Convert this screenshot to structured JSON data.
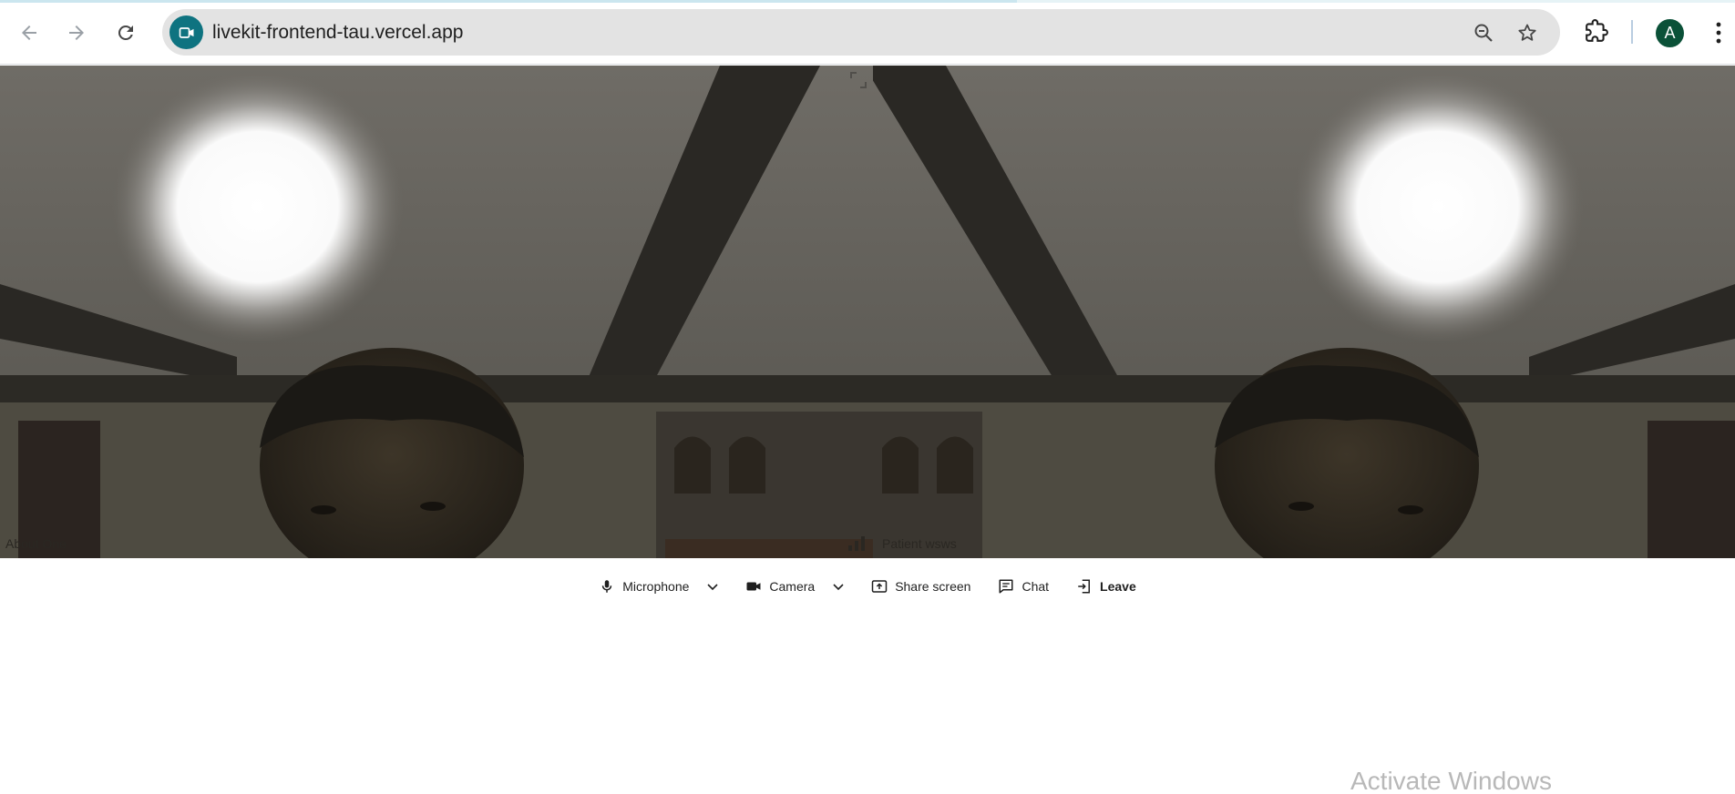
{
  "browser": {
    "url": "livekit-frontend-tau.vercel.app",
    "profile_initial": "A",
    "site_icon": "video-camera-icon",
    "accent_color": "#0e7380",
    "avatar_color": "#0b5138"
  },
  "participants": [
    {
      "name": "About One"
    },
    {
      "name": "Patient  wsws"
    }
  ],
  "controls": {
    "microphone_label": "Microphone",
    "camera_label": "Camera",
    "share_screen_label": "Share screen",
    "chat_label": "Chat",
    "leave_label": "Leave"
  },
  "watermark": {
    "text": "Activate Windows"
  }
}
